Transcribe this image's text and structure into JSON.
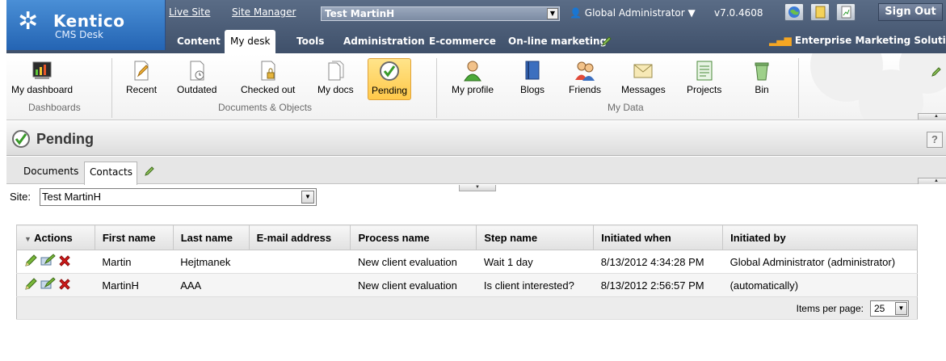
{
  "header": {
    "logo_name": "Kentico",
    "logo_sub": "CMS Desk",
    "live_site": "Live Site",
    "site_manager": "Site Manager",
    "current_site": "Test MartinH",
    "user": "Global Administrator",
    "version": "v7.0.4608",
    "sign_out": "Sign Out",
    "edition": "Enterprise Marketing Solution",
    "tabs": [
      "Content",
      "My desk",
      "Tools",
      "Administration",
      "E-commerce",
      "On-line marketing"
    ],
    "active_tab": "My desk"
  },
  "ribbon": {
    "buttons": [
      {
        "label": "My dashboard",
        "icon": "dashboard-icon"
      },
      {
        "label": "Recent",
        "icon": "recent-icon"
      },
      {
        "label": "Outdated",
        "icon": "outdated-icon"
      },
      {
        "label": "Checked out",
        "icon": "checked-out-icon"
      },
      {
        "label": "My docs",
        "icon": "my-docs-icon"
      },
      {
        "label": "Pending",
        "icon": "pending-icon",
        "selected": true
      },
      {
        "label": "My profile",
        "icon": "profile-icon"
      },
      {
        "label": "Blogs",
        "icon": "blogs-icon"
      },
      {
        "label": "Friends",
        "icon": "friends-icon"
      },
      {
        "label": "Messages",
        "icon": "messages-icon"
      },
      {
        "label": "Projects",
        "icon": "projects-icon"
      },
      {
        "label": "Bin",
        "icon": "bin-icon"
      }
    ],
    "groups": [
      "Dashboards",
      "Documents & Objects",
      "My Data"
    ]
  },
  "page": {
    "title": "Pending",
    "help": "?",
    "subtabs": [
      "Documents",
      "Contacts"
    ],
    "active_subtab": "Contacts",
    "site_label": "Site:",
    "site_value": "Test MartinH"
  },
  "grid": {
    "columns": [
      "Actions",
      "First name",
      "Last name",
      "E-mail address",
      "Process name",
      "Step name",
      "Initiated when",
      "Initiated by"
    ],
    "rows": [
      [
        "Martin",
        "Hejtmanek",
        "",
        "New client evaluation",
        "Wait 1 day",
        "8/13/2012 4:34:28 PM",
        "Global Administrator (administrator)"
      ],
      [
        "MartinH",
        "AAA",
        "",
        "New client evaluation",
        "Is client interested?",
        "8/13/2012 2:56:57 PM",
        "(automatically)"
      ]
    ],
    "items_per_page_label": "Items per page:",
    "items_per_page": "25"
  },
  "colors": {
    "header_bg": "#4a5b76",
    "logo_bg": "#2f73c4",
    "selected_button": "#ffd25e",
    "edit_icon": "#5c9e2a",
    "delete_icon": "#d21a1a"
  }
}
